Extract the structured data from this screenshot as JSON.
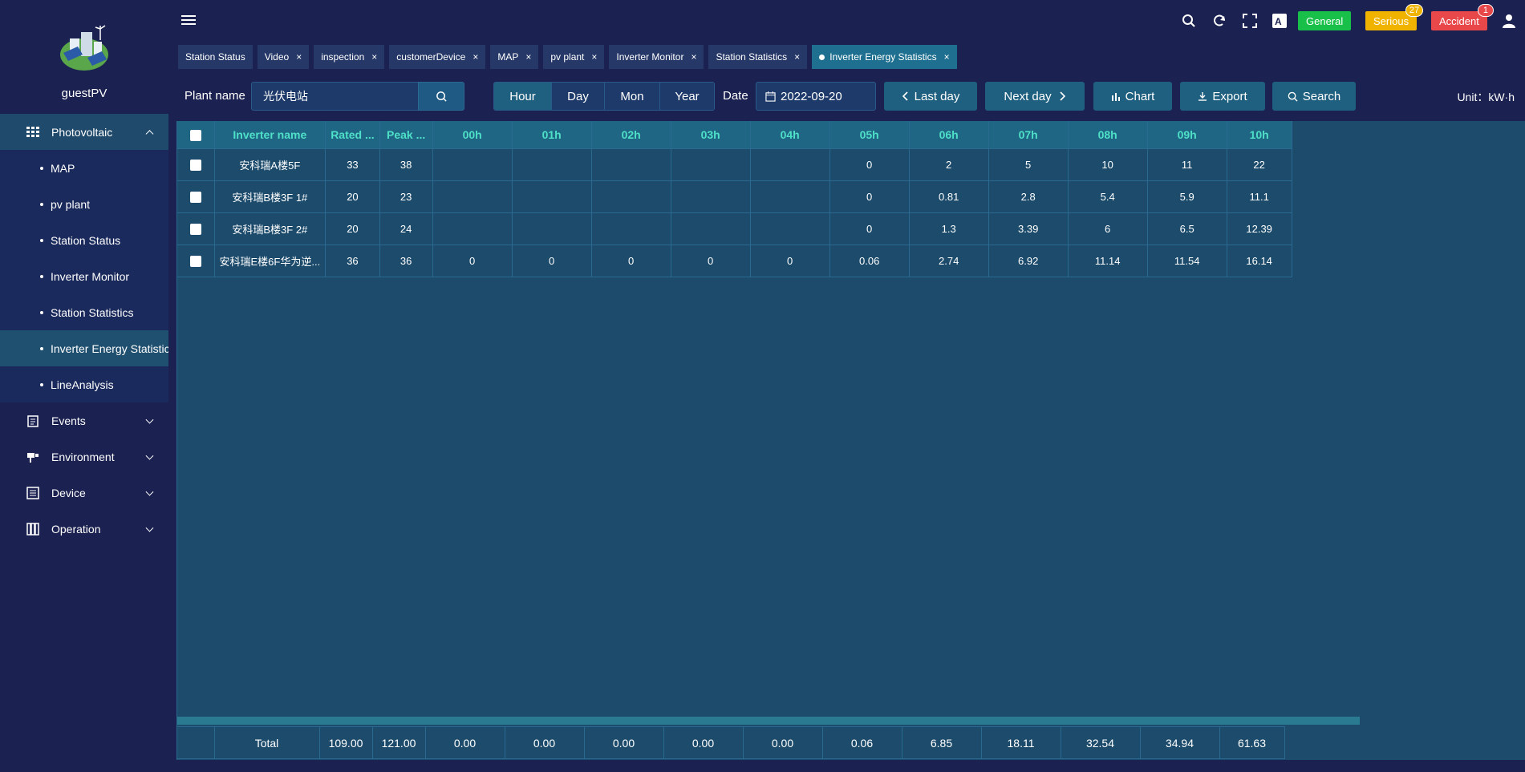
{
  "app": {
    "username": "guestPV"
  },
  "sidebar": {
    "groups": [
      {
        "label": "Photovoltaic",
        "icon": "grid-icon",
        "open": true,
        "items": [
          {
            "label": "MAP"
          },
          {
            "label": "pv plant"
          },
          {
            "label": "Station Status"
          },
          {
            "label": "Inverter Monitor"
          },
          {
            "label": "Station Statistics"
          },
          {
            "label": "Inverter Energy Statistics",
            "active": true
          },
          {
            "label": "LineAnalysis"
          }
        ]
      },
      {
        "label": "Events",
        "icon": "events-icon"
      },
      {
        "label": "Environment",
        "icon": "environment-icon"
      },
      {
        "label": "Device",
        "icon": "device-icon"
      },
      {
        "label": "Operation",
        "icon": "operation-icon"
      }
    ]
  },
  "topbar": {
    "alarms": [
      {
        "label": "General",
        "color": "#18c04a"
      },
      {
        "label": "Serious",
        "color": "#f0b400",
        "count": "27"
      },
      {
        "label": "Accident",
        "color": "#e8484a",
        "count": "1"
      }
    ]
  },
  "tabs": [
    {
      "label": "Station Status",
      "closable": false
    },
    {
      "label": "Video",
      "closable": true
    },
    {
      "label": "inspection",
      "closable": true
    },
    {
      "label": "customerDevice",
      "closable": true
    },
    {
      "label": "MAP",
      "closable": true
    },
    {
      "label": "pv plant",
      "closable": true
    },
    {
      "label": "Inverter Monitor",
      "closable": true
    },
    {
      "label": "Station Statistics",
      "closable": true
    },
    {
      "label": "Inverter Energy Statistics",
      "closable": true,
      "active": true
    }
  ],
  "filters": {
    "plant_label": "Plant name",
    "plant_value": "光伏电站",
    "period_options": [
      "Hour",
      "Day",
      "Mon",
      "Year"
    ],
    "period_selected": "Hour",
    "date_label": "Date",
    "date_value": "2022-09-20",
    "last_day": "Last day",
    "next_day": "Next day",
    "chart": "Chart",
    "export": "Export",
    "search": "Search",
    "unit": "Unit：kW·h"
  },
  "table": {
    "columns": [
      "Inverter name",
      "Rated ...",
      "Peak ...",
      "00h",
      "01h",
      "02h",
      "03h",
      "04h",
      "05h",
      "06h",
      "07h",
      "08h",
      "09h",
      "10h"
    ],
    "rows": [
      [
        "安科瑞A楼5F",
        "33",
        "38",
        "",
        "",
        "",
        "",
        "",
        "0",
        "2",
        "5",
        "10",
        "11",
        "22"
      ],
      [
        "安科瑞B楼3F 1#",
        "20",
        "23",
        "",
        "",
        "",
        "",
        "",
        "0",
        "0.81",
        "2.8",
        "5.4",
        "5.9",
        "11.1"
      ],
      [
        "安科瑞B楼3F 2#",
        "20",
        "24",
        "",
        "",
        "",
        "",
        "",
        "0",
        "1.3",
        "3.39",
        "6",
        "6.5",
        "12.39"
      ],
      [
        "安科瑞E楼6F华为逆...",
        "36",
        "36",
        "0",
        "0",
        "0",
        "0",
        "0",
        "0.06",
        "2.74",
        "6.92",
        "11.14",
        "11.54",
        "16.14"
      ]
    ],
    "total": [
      "Total",
      "109.00",
      "121.00",
      "0.00",
      "0.00",
      "0.00",
      "0.00",
      "0.00",
      "0.06",
      "6.85",
      "18.11",
      "32.54",
      "34.94",
      "61.63"
    ]
  }
}
